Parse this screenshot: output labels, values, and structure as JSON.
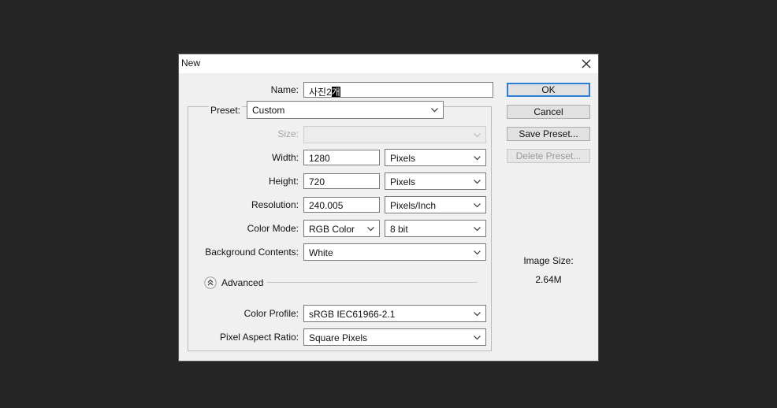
{
  "dialog": {
    "title": "New"
  },
  "name": {
    "label": "Name:",
    "value": "사진2",
    "selected_text": "개"
  },
  "preset": {
    "label": "Preset:",
    "value": "Custom"
  },
  "size": {
    "label": "Size:",
    "value": ""
  },
  "width": {
    "label": "Width:",
    "value": "1280",
    "unit": "Pixels"
  },
  "height": {
    "label": "Height:",
    "value": "720",
    "unit": "Pixels"
  },
  "resolution": {
    "label": "Resolution:",
    "value": "240.005",
    "unit": "Pixels/Inch"
  },
  "color_mode": {
    "label": "Color Mode:",
    "value": "RGB Color",
    "bits": "8 bit"
  },
  "background": {
    "label": "Background Contents:",
    "value": "White"
  },
  "advanced": {
    "label": "Advanced"
  },
  "color_profile": {
    "label": "Color Profile:",
    "value": "sRGB IEC61966-2.1"
  },
  "pixel_aspect": {
    "label": "Pixel Aspect Ratio:",
    "value": "Square Pixels"
  },
  "buttons": {
    "ok": "OK",
    "cancel": "Cancel",
    "save_preset": "Save Preset...",
    "delete_preset": "Delete Preset..."
  },
  "image_size": {
    "label": "Image Size:",
    "value": "2.64M"
  },
  "colors": {
    "background": "#262626",
    "dialog": "#f0f0f0",
    "accent": "#2c7fd6"
  },
  "icons": {
    "close": "close-icon",
    "dropdown": "chevron-down-icon",
    "advanced_toggle": "collapse-up-icon"
  }
}
